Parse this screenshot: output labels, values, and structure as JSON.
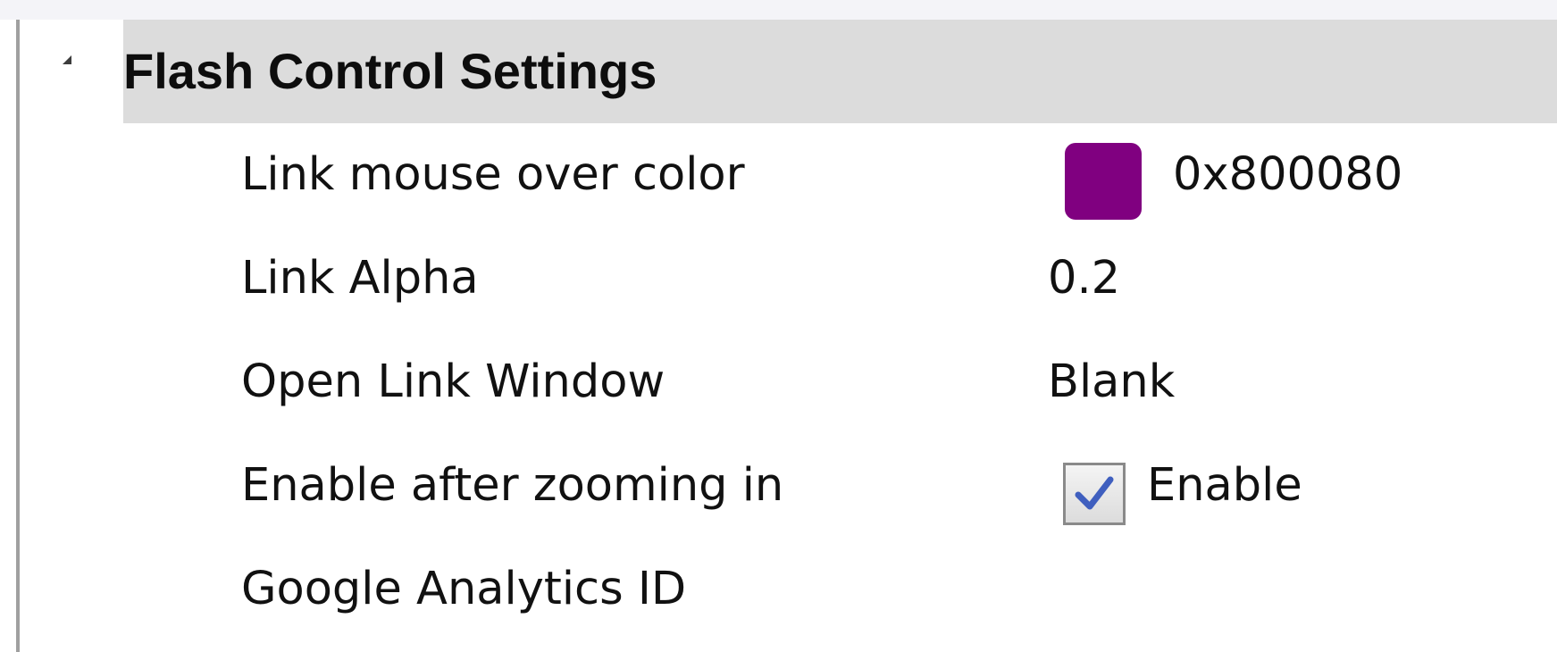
{
  "group": {
    "title": "Flash Control Settings",
    "expander_icon": "collapse-triangle-icon"
  },
  "properties": [
    {
      "label": "Link mouse over color",
      "type": "color",
      "color": "#800080",
      "value": "0x800080"
    },
    {
      "label": "Link Alpha",
      "type": "text",
      "value": "0.2"
    },
    {
      "label": "Open Link Window",
      "type": "text",
      "value": "Blank"
    },
    {
      "label": "Enable after zooming in",
      "type": "checkbox",
      "checked": true,
      "value": "Enable"
    },
    {
      "label": "Google Analytics ID",
      "type": "text",
      "value": ""
    }
  ],
  "colors": {
    "header_bg": "#dcdcdc",
    "checkmark": "#3f5fbf"
  }
}
